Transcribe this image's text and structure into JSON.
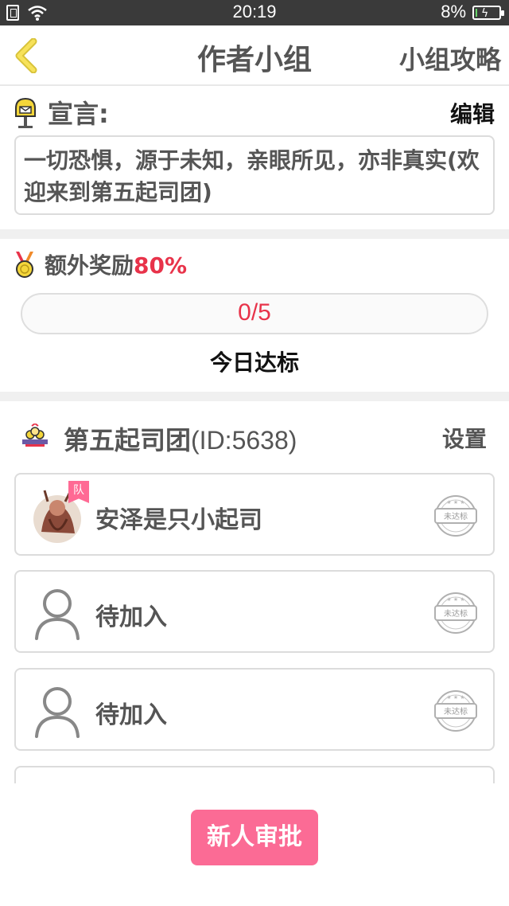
{
  "status_bar": {
    "time": "20:19",
    "battery_percent": "8%",
    "battery_level": 0.08,
    "battery_color": "#67d36a"
  },
  "header": {
    "title": "作者小组",
    "guide_label": "小组攻略",
    "back_icon": "chevron-left-icon"
  },
  "declaration": {
    "label": "宣言:",
    "edit_label": "编辑",
    "text": "一切恐惧，源于未知，亲眼所见，亦非真实(欢迎来到第五起司团)",
    "icon": "mailbox-icon"
  },
  "reward": {
    "label": "额外奖励",
    "percent": "80%",
    "progress_text": "0/5",
    "progress_value": 0,
    "status_label": "今日达标",
    "icon": "medal-icon",
    "accent_color": "#e8334a"
  },
  "group": {
    "title": "第五起司团",
    "id_text": "(ID:5638)",
    "settings_label": "设置",
    "icon": "group-icon"
  },
  "members": [
    {
      "name": "安泽是只小起司",
      "stamp": "未达标",
      "leader_badge": "队",
      "avatar": "user-avatar"
    },
    {
      "name": "待加入",
      "stamp": "未达标",
      "avatar": "person-placeholder-icon"
    },
    {
      "name": "待加入",
      "stamp": "未达标",
      "avatar": "person-placeholder-icon"
    },
    {
      "name": "",
      "stamp": "",
      "avatar": "person-placeholder-icon"
    }
  ],
  "approve_button": {
    "label": "新人审批",
    "color": "#fb6b95"
  }
}
